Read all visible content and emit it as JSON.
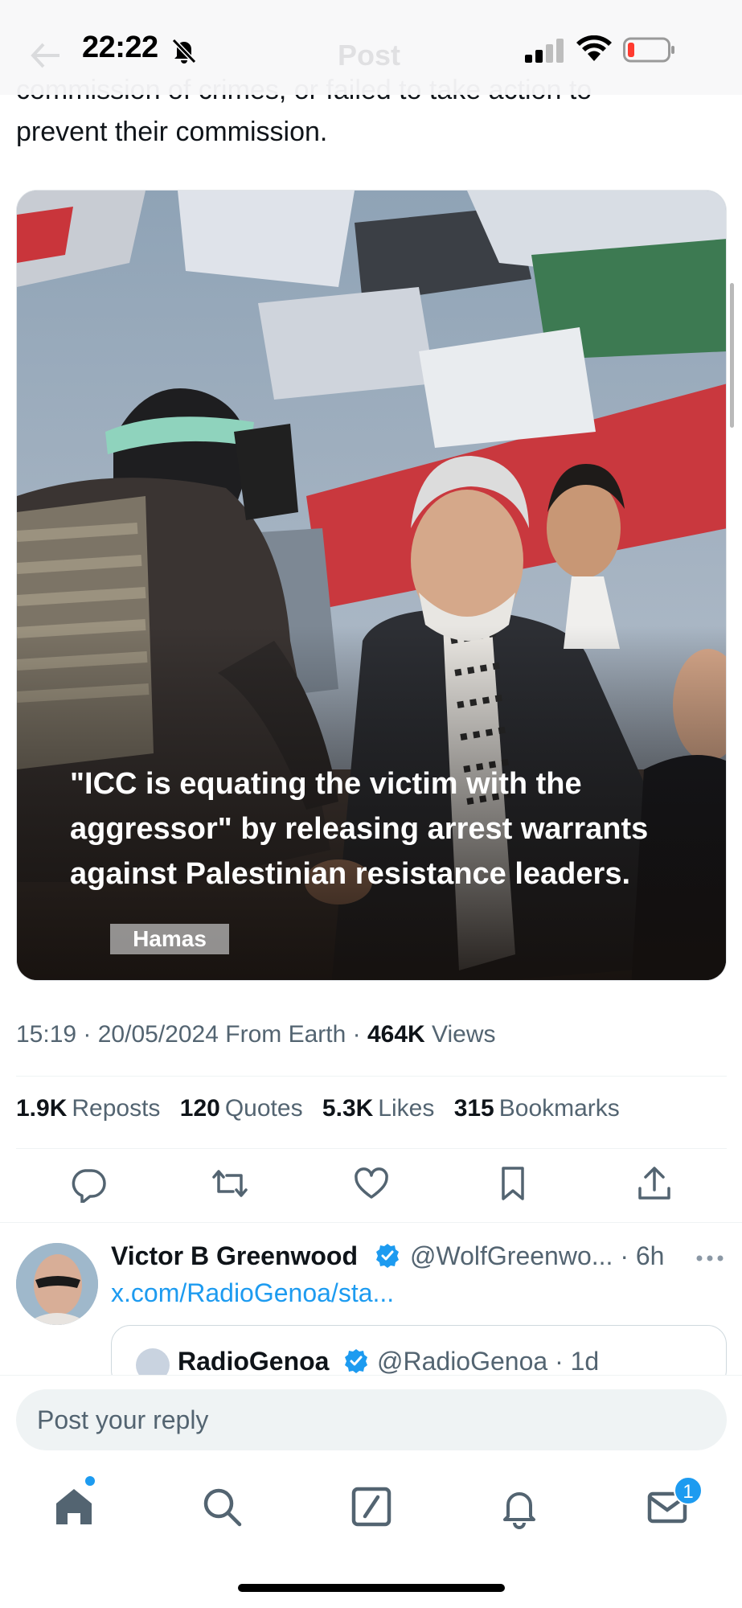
{
  "status_bar": {
    "time": "22:22",
    "icons": [
      "bell-off-icon",
      "signal-icon",
      "wifi-icon",
      "battery-low-icon"
    ]
  },
  "header": {
    "title": "Post",
    "back_icon": "back-arrow-icon"
  },
  "tweet": {
    "text_lines": [
      "commission of crimes, or failed to take action to",
      "prevent their commission."
    ],
    "media": {
      "quote_lines": [
        "\"ICC is equating the victim with the",
        "aggressor\" by releasing arrest warrants",
        "against Palestinian resistance leaders."
      ],
      "tag": "Hamas"
    },
    "meta": {
      "time": "15:19",
      "date": "20/05/2024",
      "source": "From Earth",
      "views_count": "464K",
      "views_label": "Views"
    },
    "stats": [
      {
        "count": "1.9K",
        "label": "Reposts"
      },
      {
        "count": "120",
        "label": "Quotes"
      },
      {
        "count": "5.3K",
        "label": "Likes"
      },
      {
        "count": "315",
        "label": "Bookmarks"
      }
    ],
    "actions": [
      "reply-icon",
      "repost-icon",
      "like-icon",
      "bookmark-icon",
      "share-icon"
    ]
  },
  "reply": {
    "name": "Victor B Greenwood",
    "handle_time": "@WolfGreenwo... · 6h",
    "link": "x.com/RadioGenoa/sta...",
    "quoted": {
      "name": "RadioGenoa",
      "handle_time": "@RadioGenoa · 1d"
    }
  },
  "composer": {
    "placeholder": "Post your reply"
  },
  "tabbar": {
    "items": [
      "home-icon",
      "search-icon",
      "compose-icon",
      "notifications-icon",
      "messages-icon"
    ],
    "messages_badge": "1"
  },
  "colors": {
    "accent": "#1d9bf0",
    "text": "#0f1419",
    "secondary": "#536471"
  }
}
